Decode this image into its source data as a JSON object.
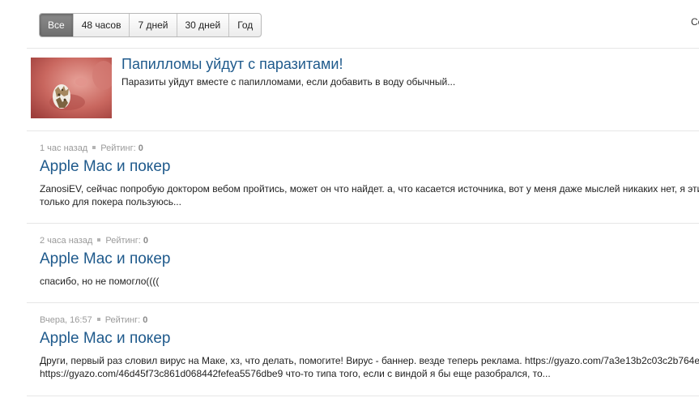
{
  "filters": {
    "items": [
      {
        "label": "Все",
        "active": true
      },
      {
        "label": "48 часов",
        "active": false
      },
      {
        "label": "7 дней",
        "active": false
      },
      {
        "label": "30 дней",
        "active": false
      },
      {
        "label": "Год",
        "active": false
      }
    ],
    "cut_label": "Со"
  },
  "ad": {
    "title": "Папилломы уйдут с паразитами!",
    "text": "Паразиты уйдут вместе с папилломами, если добавить в воду обычный..."
  },
  "posts": [
    {
      "time": "1 час назад",
      "rating_label": "Рейтинг:",
      "rating_value": "0",
      "title": "Apple Mac и покер",
      "text_line1": "ZanosiEV, сейчас попробую доктором вебом пройтись, может он что найдет. а, что касается источника, вот у меня даже мыслей никаких нет, я эти",
      "text_line2": "только для покера пользуюсь..."
    },
    {
      "time": "2 часа назад",
      "rating_label": "Рейтинг:",
      "rating_value": "0",
      "title": "Apple Mac и покер",
      "text_line1": "спасибо, но не помогло((((",
      "text_line2": ""
    },
    {
      "time": "Вчера, 16:57",
      "rating_label": "Рейтинг:",
      "rating_value": "0",
      "title": "Apple Mac и покер",
      "text_line1": "Други, первый раз словил вирус на Маке, хз, что делать, помогите! Вирус - баннер. везде теперь реклама. https://gyazo.com/7a3e13b2c03c2b764e",
      "text_line2": "https://gyazo.com/46d45f73c861d068442fefea5576dbe9 что-то типа того, если с виндой я бы еще разобрался, то..."
    }
  ],
  "colors": {
    "link": "#1f5a8c",
    "meta": "#9a9a9a",
    "active_filter": "#7a7a7a"
  }
}
